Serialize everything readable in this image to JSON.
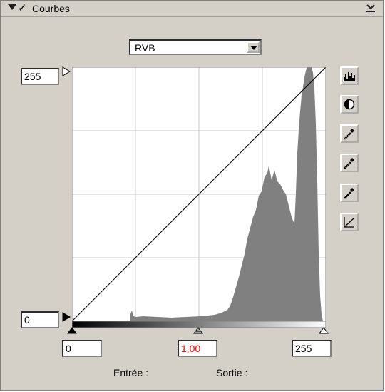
{
  "panel": {
    "title": "Courbes",
    "channel_select": {
      "value": "RVB"
    }
  },
  "curve": {
    "output_max": "255",
    "output_min": "0",
    "input_black": "0",
    "gamma": "1,00",
    "input_white": "255"
  },
  "labels": {
    "input": "Entrée :",
    "output": "Sortie :"
  },
  "colors": {
    "panel_bg": "#d4d0c8",
    "histogram": "#808080",
    "grid": "#c8c8c8",
    "gamma_text": "#ff0000"
  },
  "tools": [
    {
      "icon": "histogram-icon"
    },
    {
      "icon": "contrast-icon"
    },
    {
      "icon": "black-eyedropper-icon"
    },
    {
      "icon": "gray-eyedropper-icon"
    },
    {
      "icon": "white-eyedropper-icon"
    },
    {
      "icon": "curve-reset-icon"
    }
  ]
}
